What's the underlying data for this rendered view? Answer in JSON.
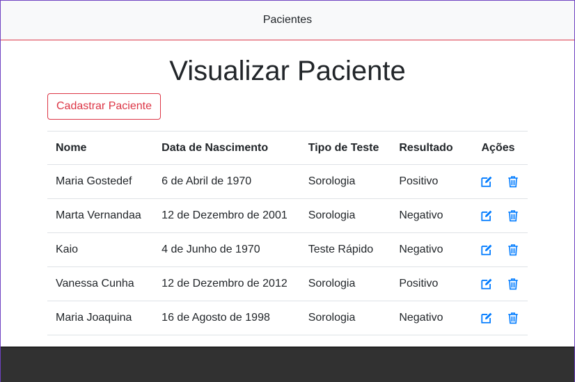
{
  "navbar": {
    "brand": "Pacientes"
  },
  "page": {
    "title": "Visualizar Paciente",
    "add_button_label": "Cadastrar Paciente"
  },
  "table": {
    "headers": {
      "name": "Nome",
      "dob": "Data de Nascimento",
      "test_type": "Tipo de Teste",
      "result": "Resultado",
      "actions": "Ações"
    },
    "rows": [
      {
        "name": "Maria Gostedef",
        "dob": "6 de Abril de 1970",
        "test_type": "Sorologia",
        "result": "Positivo"
      },
      {
        "name": "Marta Vernandaa",
        "dob": "12 de Dezembro de 2001",
        "test_type": "Sorologia",
        "result": "Negativo"
      },
      {
        "name": "Kaio",
        "dob": "4 de Junho de 1970",
        "test_type": "Teste Rápido",
        "result": "Negativo"
      },
      {
        "name": "Vanessa Cunha",
        "dob": "12 de Dezembro de 2012",
        "test_type": "Sorologia",
        "result": "Positivo"
      },
      {
        "name": "Maria Joaquina",
        "dob": "16 de Agosto de 1998",
        "test_type": "Sorologia",
        "result": "Negativo"
      }
    ],
    "row_actions": {
      "edit_icon": "edit-icon",
      "delete_icon": "trash-icon"
    }
  },
  "colors": {
    "accent": "#dc3545",
    "action_icon": "#007bff",
    "footer": "#313131",
    "navbar_bg": "#f8f9fa"
  }
}
